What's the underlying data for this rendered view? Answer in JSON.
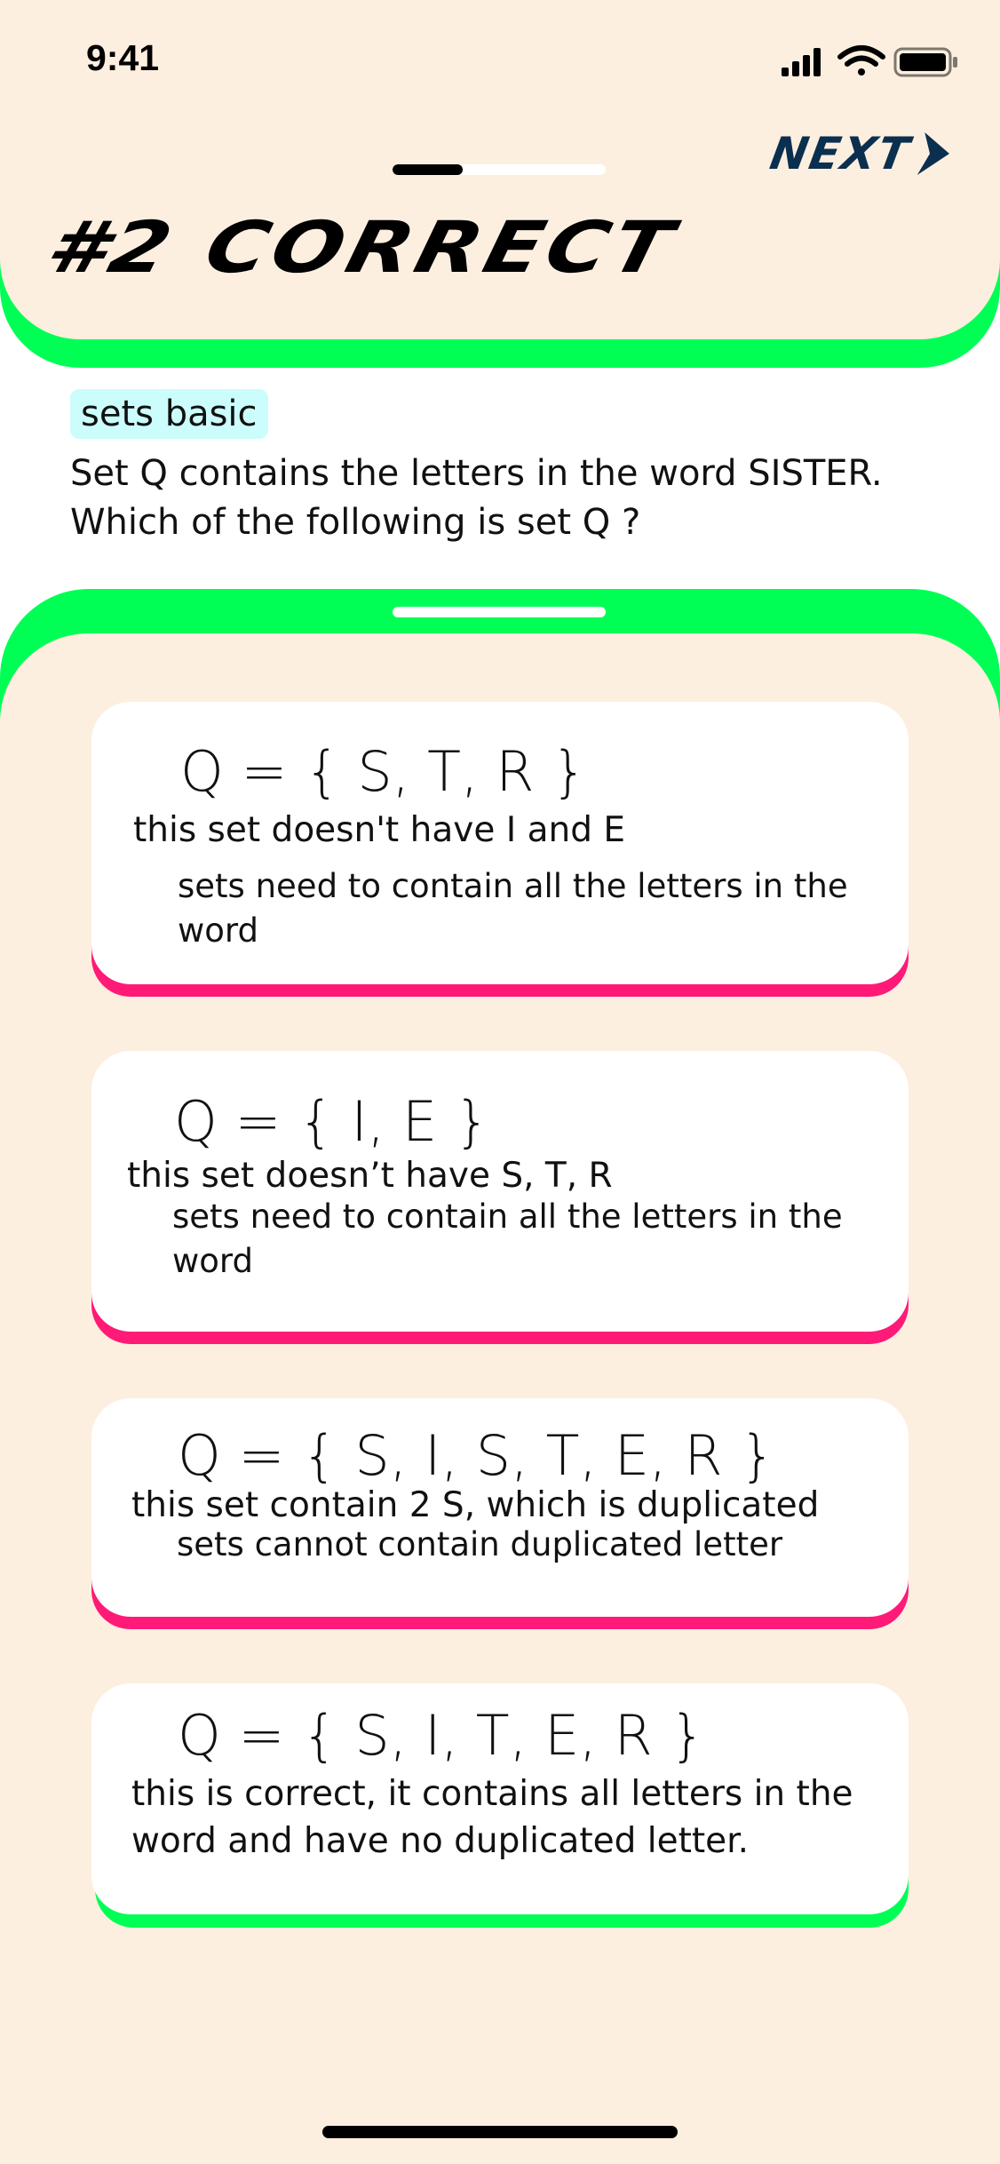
{
  "status": {
    "time": "9:41"
  },
  "header": {
    "next_label": "NEXT",
    "result_title": "#2 CORRECT",
    "progress": 0.33
  },
  "question": {
    "tag": "sets basic",
    "text": "Set  Q  contains the letters in the word  SISTER.\n Which of the following is set  Q ?"
  },
  "answers": [
    {
      "formula": "Q = { S, T, R }",
      "feedback": "this set doesn't have I and E",
      "hint": "sets need to contain all the letters in the word",
      "result": "wrong"
    },
    {
      "formula": "Q = { I, E }",
      "feedback": "this set doesn’t have S, T, R",
      "hint": "sets need to contain all the letters in the word",
      "result": "wrong"
    },
    {
      "formula": "Q = { S, I, S, T, E, R }",
      "feedback": "this set contain 2 S, which is duplicated",
      "hint": "sets cannot contain duplicated letter",
      "result": "wrong"
    },
    {
      "formula": "Q = { S, I, T, E, R }",
      "feedback": "this is correct, it contains all letters in the word and have no duplicated letter.",
      "result": "correct"
    }
  ],
  "colors": {
    "background": "#fdefdf",
    "accent_green": "#00ff55",
    "wrong_pink": "#ff1a78",
    "next_navy": "#0b2f4f",
    "tag_cyan": "#ccfdfd"
  },
  "icons": [
    "signal-icon",
    "wifi-icon",
    "battery-icon",
    "chevron-right-icon"
  ]
}
